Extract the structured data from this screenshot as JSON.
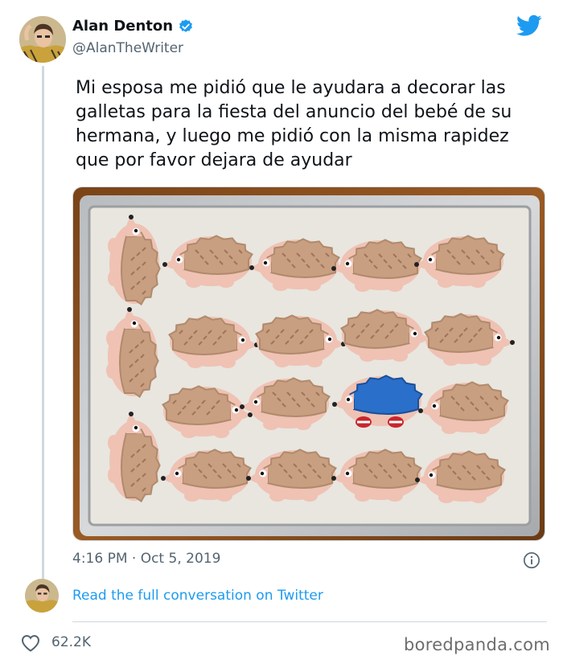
{
  "tweet": {
    "display_name": "Alan Denton",
    "handle": "@AlanTheWriter",
    "text": "Mi esposa me pidió que le ayudara a decorar las galletas para la fiesta del anuncio del bebé de su hermana, y luego me pidió con la misma rapidez que por favor dejara de ayudar",
    "timestamp": "4:16 PM · Oct 5, 2019",
    "read_more": "Read the full conversation on Twitter",
    "like_count": "62.2K"
  },
  "watermark": "boredpanda.com",
  "icons": {
    "logo": "twitter-bird-icon",
    "verified": "verified-badge-icon",
    "info": "info-icon",
    "like": "heart-icon"
  },
  "colors": {
    "brand_blue": "#1d9bf0",
    "secondary_text": "#536471",
    "primary_text": "#0f1419",
    "cookie_tan": "#c89f80",
    "cookie_pink": "#efc2b4",
    "blue_cookie": "#2a6fc9"
  }
}
